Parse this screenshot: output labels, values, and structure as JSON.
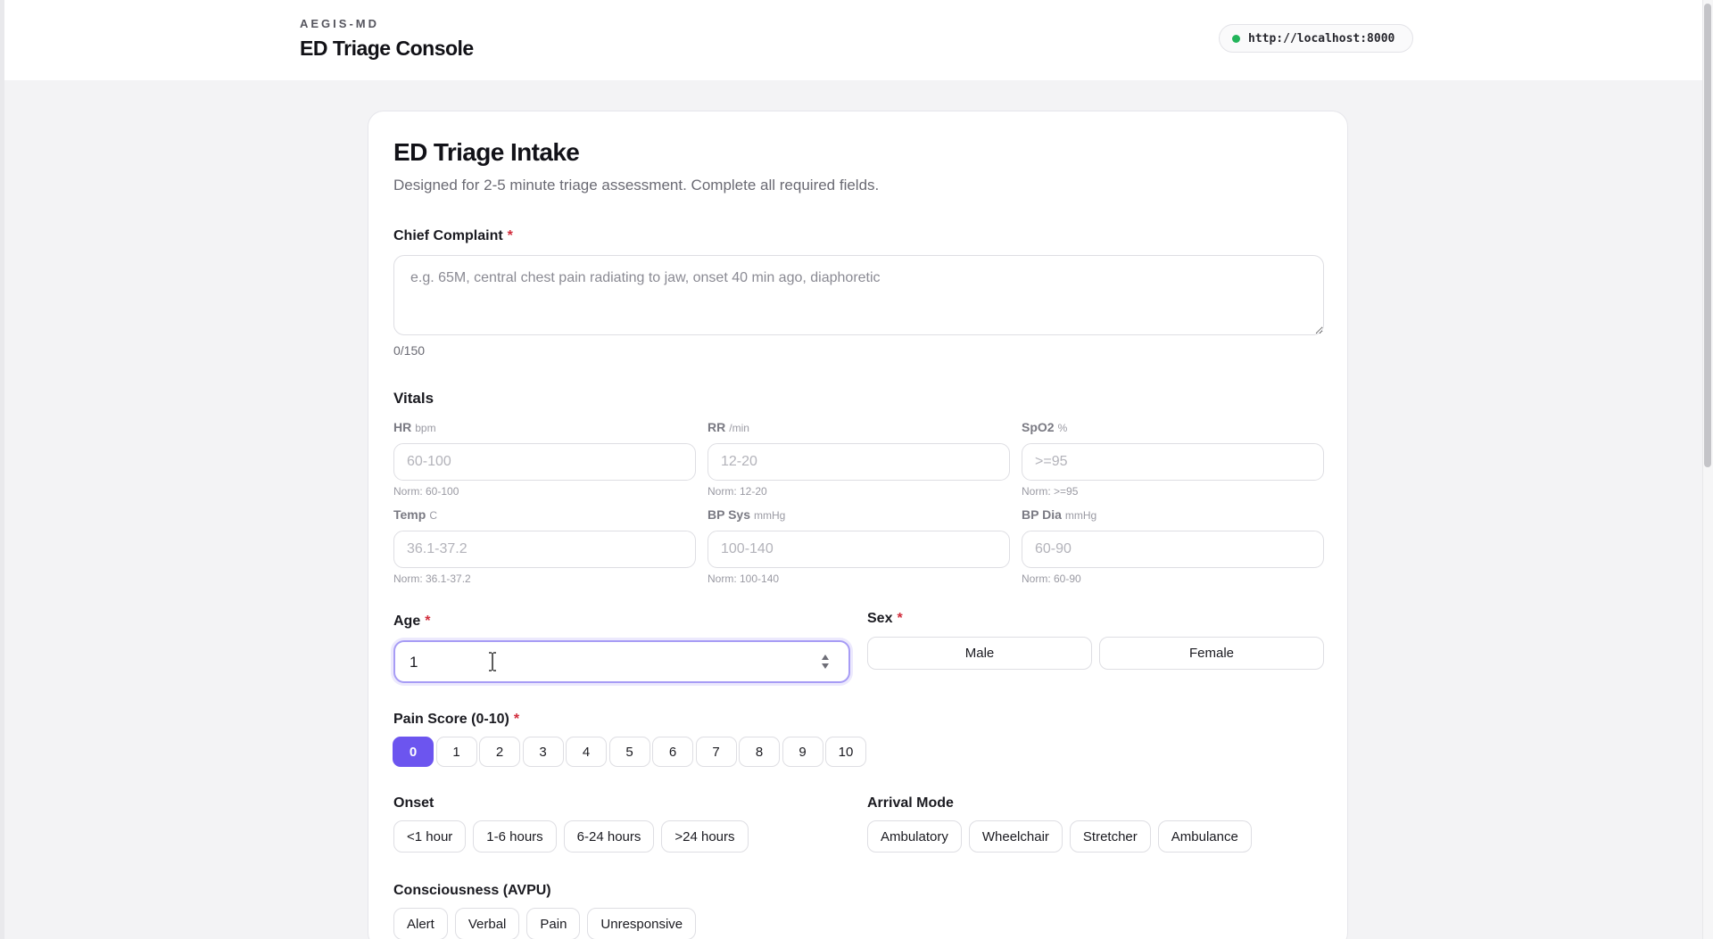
{
  "header": {
    "kicker": "AEGIS-MD",
    "title": "ED Triage Console",
    "server_url": "http://localhost:8000",
    "server_status_color": "#22b45a"
  },
  "form": {
    "title": "ED Triage Intake",
    "subtitle": "Designed for 2-5 minute triage assessment. Complete all required fields.",
    "required_mark": "*",
    "chief_complaint": {
      "label": "Chief Complaint",
      "placeholder": "e.g. 65M, central chest pain radiating to jaw, onset 40 min ago, diaphoretic",
      "value": "",
      "counter": "0/150"
    },
    "vitals": {
      "title": "Vitals",
      "fields": [
        {
          "label": "HR",
          "unit": "bpm",
          "placeholder": "60-100",
          "norm": "Norm: 60-100"
        },
        {
          "label": "RR",
          "unit": "/min",
          "placeholder": "12-20",
          "norm": "Norm: 12-20"
        },
        {
          "label": "SpO2",
          "unit": "%",
          "placeholder": ">=95",
          "norm": "Norm: >=95"
        },
        {
          "label": "Temp",
          "unit": "C",
          "placeholder": "36.1-37.2",
          "norm": "Norm: 36.1-37.2"
        },
        {
          "label": "BP Sys",
          "unit": "mmHg",
          "placeholder": "100-140",
          "norm": "Norm: 100-140"
        },
        {
          "label": "BP Dia",
          "unit": "mmHg",
          "placeholder": "60-90",
          "norm": "Norm: 60-90"
        }
      ]
    },
    "age": {
      "label": "Age",
      "value": "1"
    },
    "sex": {
      "label": "Sex",
      "options": [
        "Male",
        "Female"
      ]
    },
    "pain": {
      "label": "Pain Score (0-10)",
      "options": [
        "0",
        "1",
        "2",
        "3",
        "4",
        "5",
        "6",
        "7",
        "8",
        "9",
        "10"
      ],
      "selected": "0",
      "accent": "#6c55ef"
    },
    "onset": {
      "label": "Onset",
      "options": [
        "<1 hour",
        "1-6 hours",
        "6-24 hours",
        ">24 hours"
      ]
    },
    "arrival": {
      "label": "Arrival Mode",
      "options": [
        "Ambulatory",
        "Wheelchair",
        "Stretcher",
        "Ambulance"
      ]
    },
    "avpu": {
      "label": "Consciousness (AVPU)",
      "options": [
        "Alert",
        "Verbal",
        "Pain",
        "Unresponsive"
      ]
    }
  }
}
